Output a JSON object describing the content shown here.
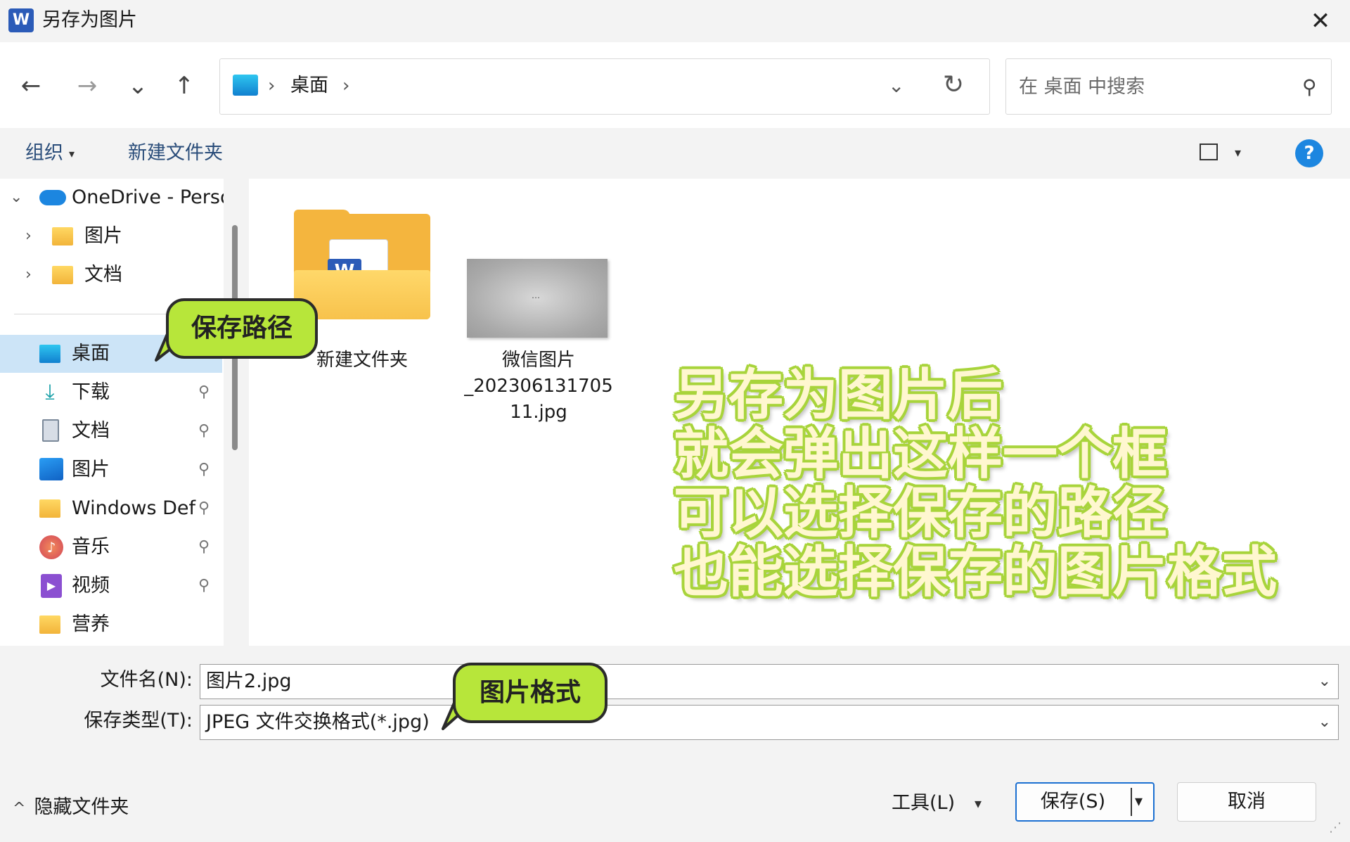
{
  "window": {
    "title": "另存为图片",
    "app_icon_letter": "W",
    "close_glyph": "✕"
  },
  "toolbar": {
    "back_glyph": "←",
    "forward_glyph": "→",
    "recent_glyph": "⌄",
    "up_glyph": "↑"
  },
  "address": {
    "sep_glyph": "›",
    "crumb": "桌面",
    "dropdown_glyph": "⌄",
    "refresh_glyph": "↻"
  },
  "search": {
    "placeholder": "在 桌面 中搜索",
    "icon_glyph": "⚲"
  },
  "commands": {
    "organize": "组织",
    "organize_caret": "▾",
    "new_folder": "新建文件夹",
    "view_caret": "▾",
    "help": "?"
  },
  "nav": {
    "items": [
      {
        "label": "OneDrive - Perso",
        "chevron": "⌄",
        "icon": "cloud-icon"
      },
      {
        "label": "图片",
        "chevron": "›",
        "icon": "folder-icon"
      },
      {
        "label": "文档",
        "chevron": "›",
        "icon": "folder-icon"
      },
      {
        "label": "桌面",
        "icon": "desktop-icon",
        "selected": true
      },
      {
        "label": "下载",
        "icon": "download-icon",
        "pin": "📌"
      },
      {
        "label": "文档",
        "icon": "documents-icon",
        "pin": "📌"
      },
      {
        "label": "图片",
        "icon": "pictures-icon",
        "pin": "📌"
      },
      {
        "label": "Windows Def",
        "icon": "folder-icon",
        "pin": "📌"
      },
      {
        "label": "音乐",
        "icon": "music-icon",
        "pin": "📌"
      },
      {
        "label": "视频",
        "icon": "video-icon",
        "pin": "📌"
      },
      {
        "label": "营养",
        "icon": "folder-icon"
      }
    ]
  },
  "files": [
    {
      "name": "新建文件夹",
      "type": "folder"
    },
    {
      "name_line1": "微信图片",
      "name_line2": "_202306131705",
      "name_line3": "11.jpg",
      "type": "image"
    }
  ],
  "annotations": {
    "overlay_lines": [
      "另存为图片后",
      "就会弹出这样一个框",
      "可以选择保存的路径",
      "也能选择保存的图片格式"
    ],
    "callout_path": "保存路径",
    "callout_format": "图片格式",
    "accent_color": "#b7e63a"
  },
  "form": {
    "filename_label": "文件名(N):",
    "filename_value": "图片2.jpg",
    "filetype_label": "保存类型(T):",
    "filetype_value": "JPEG 文件交换格式(*.jpg)",
    "chevron": "⌄"
  },
  "footer": {
    "hide_folders": "隐藏文件夹",
    "hide_caret": "^",
    "tools": "工具(L)",
    "tools_caret": "▾",
    "save": "保存(S)",
    "save_caret": "▾",
    "cancel": "取消"
  }
}
